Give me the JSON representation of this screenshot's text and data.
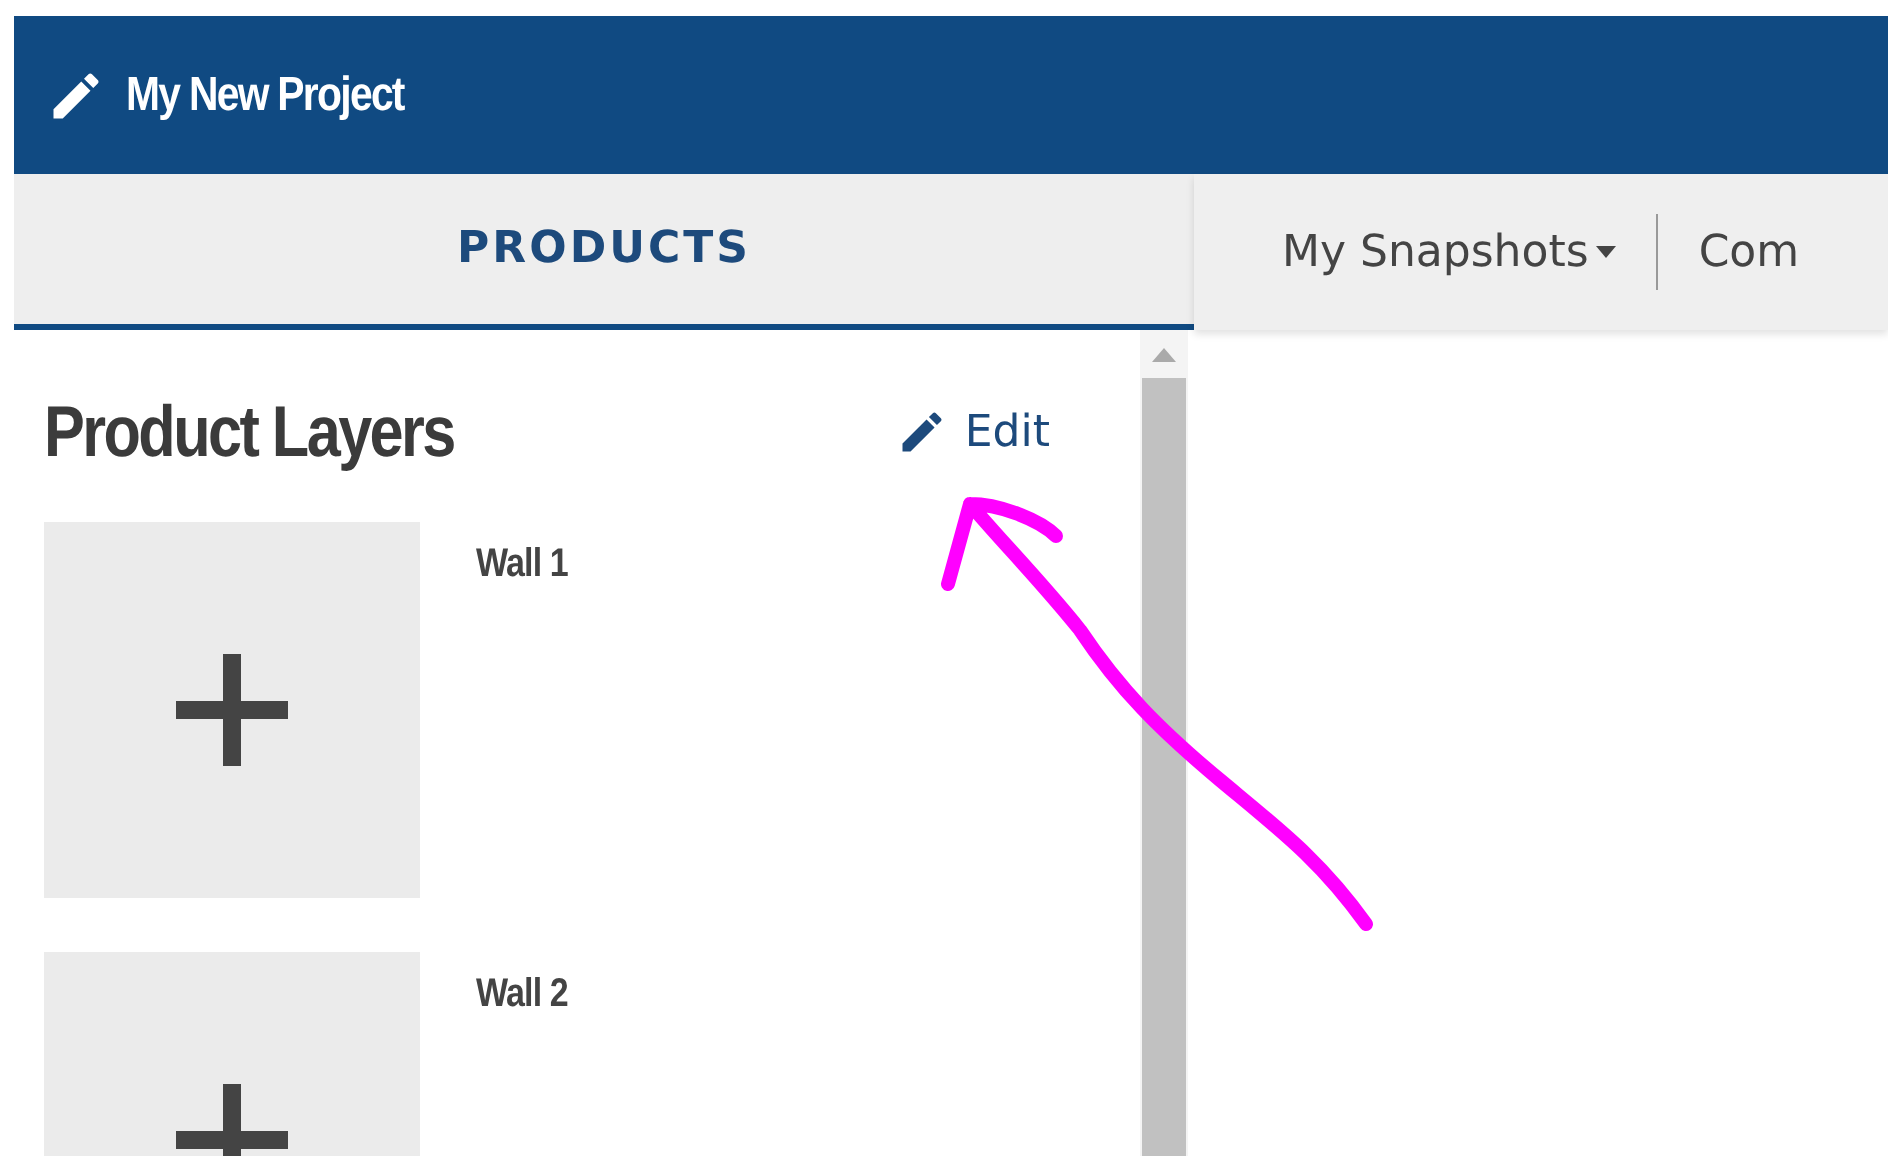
{
  "header": {
    "title": "My New Project"
  },
  "panel_tabs": [
    {
      "label": "PRODUCTS",
      "selected": true
    }
  ],
  "toolbar": [
    {
      "label": "My Snapshots",
      "kind": "dropdown"
    },
    {
      "label": "Com",
      "kind": "link"
    }
  ],
  "product_layers": {
    "title": "Product Layers",
    "edit_label": "Edit",
    "layers": [
      {
        "name": "Wall 1"
      },
      {
        "name": "Wall 2"
      }
    ]
  }
}
